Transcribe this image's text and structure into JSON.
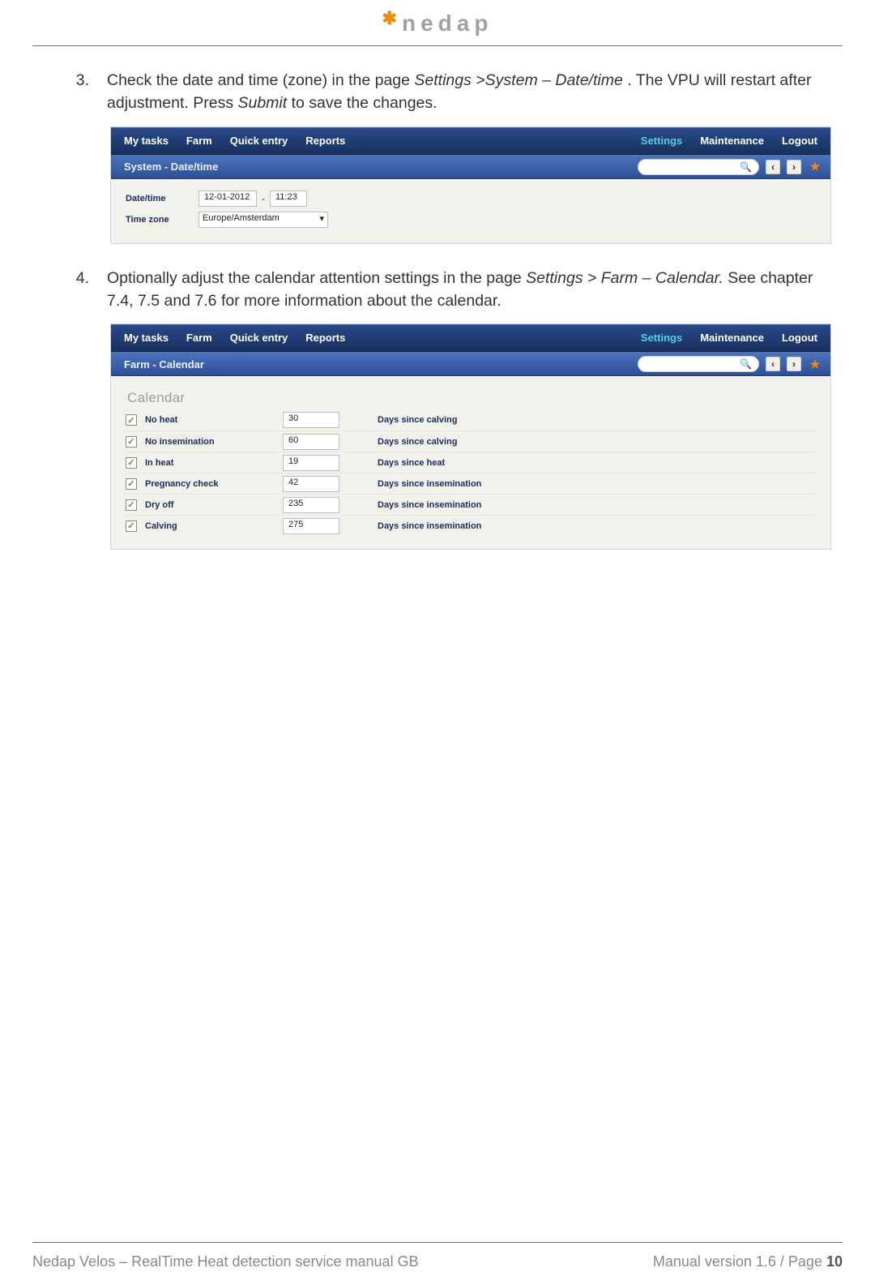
{
  "header": {
    "brand": "nedap"
  },
  "footer": {
    "left": "Nedap Velos – RealTime Heat detection service manual GB",
    "right_prefix": "Manual version 1.6 / Page ",
    "page_no": "10"
  },
  "step3": {
    "num": "3.",
    "text_a": "Check the date and time (zone) in the page ",
    "path": "Settings >System – Date/time",
    "text_b": ". The VPU will restart after adjustment. Press ",
    "submit": "Submit",
    "text_c": " to save the changes."
  },
  "shot1": {
    "menu": [
      "My tasks",
      "Farm",
      "Quick entry",
      "Reports"
    ],
    "right_menu": {
      "settings": "Settings",
      "maint": "Maintenance",
      "logout": "Logout"
    },
    "title": "System - Date/time",
    "rows": {
      "datetime_label": "Date/time",
      "date": "12-01-2012",
      "sep": "-",
      "time": "11:23",
      "tz_label": "Time zone",
      "tz_value": "Europe/Amsterdam"
    }
  },
  "step4": {
    "num": "4.",
    "text_a": "Optionally adjust the calendar attention settings in the page ",
    "path": "Settings > Farm – Calendar.",
    "text_b": " See chapter 7.4, 7.5 and 7.6 for more information about the calendar."
  },
  "shot2": {
    "menu": [
      "My tasks",
      "Farm",
      "Quick entry",
      "Reports"
    ],
    "right_menu": {
      "settings": "Settings",
      "maint": "Maintenance",
      "logout": "Logout"
    },
    "title": "Farm - Calendar",
    "section": "Calendar",
    "rows": [
      {
        "name": "No heat",
        "value": "30",
        "desc": "Days since calving"
      },
      {
        "name": "No insemination",
        "value": "60",
        "desc": "Days since calving"
      },
      {
        "name": "In heat",
        "value": "19",
        "desc": "Days since heat"
      },
      {
        "name": "Pregnancy check",
        "value": "42",
        "desc": "Days since insemination"
      },
      {
        "name": "Dry off",
        "value": "235",
        "desc": "Days since insemination"
      },
      {
        "name": "Calving",
        "value": "275",
        "desc": "Days since insemination"
      }
    ]
  }
}
